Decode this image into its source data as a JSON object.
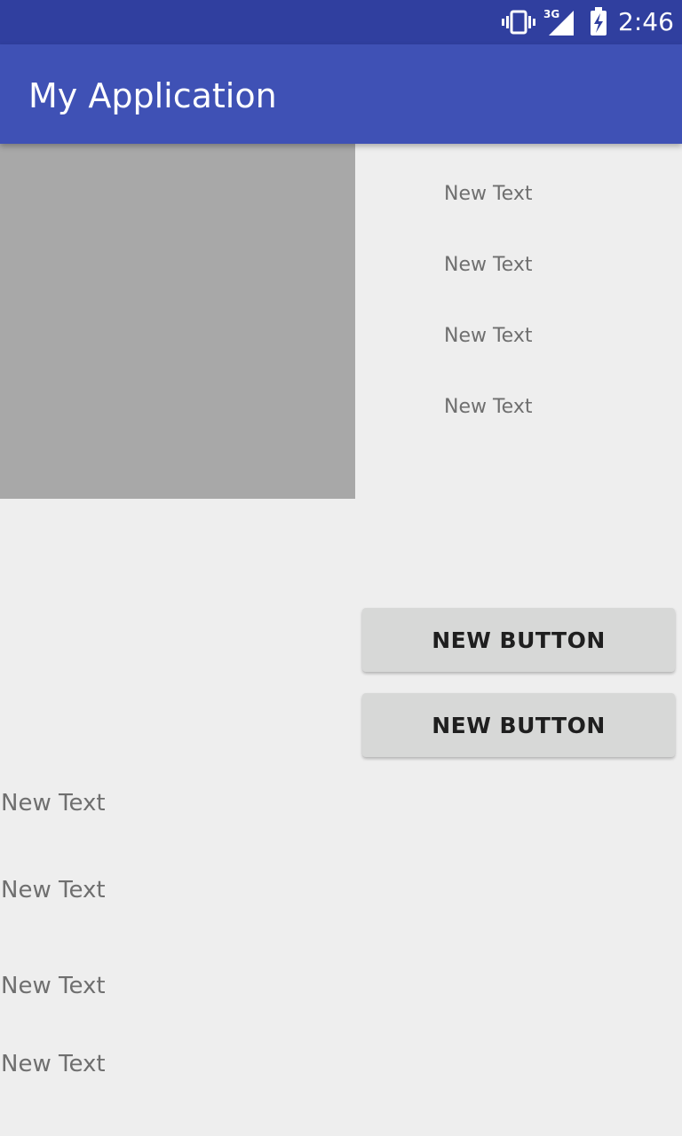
{
  "status_bar": {
    "time": "2:46",
    "network_label": "3G",
    "icons": [
      "vibrate-icon",
      "signal-3g-icon",
      "battery-charging-icon"
    ]
  },
  "app_bar": {
    "title": "My Application",
    "color": "#3f51b5",
    "status_color": "#303f9f"
  },
  "top_texts": [
    "New Text",
    "New Text",
    "New Text",
    "New Text"
  ],
  "buttons": [
    "NEW BUTTON",
    "NEW BUTTON"
  ],
  "bottom_texts": [
    "New Text",
    "New Text",
    "New Text",
    "New Text"
  ]
}
